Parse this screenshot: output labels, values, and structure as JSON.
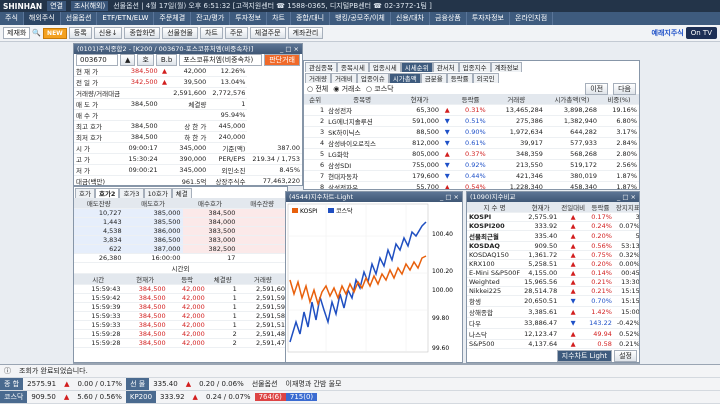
{
  "topbar": {
    "brand": "SHINHAN",
    "tabs": [
      "연결",
      "조사(해외)"
    ],
    "info": "선물옵션  |  4월 17일(월) 오후 6:51:32 [고객지원센터 ☎ 1588-0365, 디지털PB센터 ☎ 02-3772-1팀 ]"
  },
  "menu": [
    "주식",
    "해외주식",
    "선물옵션",
    "ETF/ETN/ELW",
    "주문체결",
    "잔고/평가",
    "투자정보",
    "차트",
    "종합/대니",
    "뱅킹/공모주/이체",
    "신용/대차",
    "금융상품",
    "투자자정보",
    "온라인지점"
  ],
  "toolbar": {
    "screen_no": "제재화",
    "new": "NEW",
    "items": [
      "등록",
      "신용↓",
      "종합화면",
      "선물현물",
      "차트",
      "주문",
      "체결주문",
      "계좌관리"
    ],
    "logo": "예래지주식",
    "tv": "On TV"
  },
  "w1": {
    "title": "(0101)주식종합2 - [K200 / 003670-포스코퓨처엠(비중속차)]",
    "code": "003670",
    "btns": [
      "▲",
      "호",
      "B.b"
    ],
    "name": "포스코퓨처엠(비중속차)",
    "trade_btn": "판단거래",
    "rows": [
      [
        "현 재 가",
        "384,500",
        "▲",
        "42,000",
        "12.26%"
      ],
      [
        "전 일 가",
        "342,500",
        "▲",
        "39,500",
        "13.04%"
      ],
      [
        "거래량/거래대금",
        "",
        "",
        "2,591,600",
        "2,772,576"
      ],
      [
        "매 도 가",
        "384,500",
        "",
        "체결량",
        "1"
      ],
      [
        "매 수 가",
        "",
        "",
        "",
        "95.94%"
      ],
      [
        "최고 호가",
        "384,500",
        "",
        "상 한 가",
        "445,000"
      ],
      [
        "최저 호가",
        "384,500",
        "",
        "하 한 가",
        "240,000"
      ],
      [
        "시   가",
        "09:00:17",
        "",
        "345,000",
        "기준(액)",
        "387.00"
      ],
      [
        "고   가",
        "15:30:24",
        "",
        "390,000",
        "PER/EPS",
        "219.34 / 1,753"
      ],
      [
        "저   가",
        "09:00:21",
        "",
        "345,000",
        "외인소진",
        "8.45%"
      ],
      [
        "대금(백만)",
        "",
        "",
        "961.5억",
        "상장주식수",
        "77,463,220"
      ],
      [
        "시가총액(억)",
        "",
        "",
        "297,846",
        "평균가격",
        "371,308"
      ]
    ]
  },
  "w2": {
    "tabs1": [
      "관심종목",
      "종목시세",
      "업종시세",
      "시세순위",
      "관서처",
      "업종지수",
      "계좌정보"
    ],
    "tabs2": [
      "거래량",
      "거래비",
      "업종이슈",
      "시가총액",
      "금분율",
      "등락률",
      "외국인"
    ],
    "opts": [
      "전체",
      "거래소",
      "코스닥"
    ],
    "btns": [
      "이전",
      "다음"
    ],
    "headers": [
      "순위",
      "종목명",
      "현재가",
      "",
      "등락률",
      "거래량",
      "시가총액(억)",
      "비중(%)"
    ],
    "rows": [
      [
        "1",
        "삼성전자",
        "65,300",
        "▲",
        "0.31%",
        "13,465,284",
        "3,898,268",
        "19.16%"
      ],
      [
        "2",
        "LG에너지솔루션",
        "591,000",
        "▼",
        "0.51%",
        "275,386",
        "1,382,940",
        "6.80%"
      ],
      [
        "3",
        "SK하이닉스",
        "88,500",
        "▼",
        "0.90%",
        "1,972,634",
        "644,282",
        "3.17%"
      ],
      [
        "4",
        "삼성바이오로직스",
        "812,000",
        "▼",
        "0.61%",
        "39,917",
        "577,933",
        "2.84%"
      ],
      [
        "5",
        "LG화학",
        "805,000",
        "▲",
        "0.37%",
        "348,359",
        "568,268",
        "2.80%"
      ],
      [
        "6",
        "삼성SDI",
        "755,000",
        "▼",
        "0.92%",
        "213,550",
        "519,172",
        "2.56%"
      ],
      [
        "7",
        "현대자동차",
        "179,600",
        "▼",
        "0.44%",
        "421,346",
        "380,019",
        "1.87%"
      ],
      [
        "8",
        "삼성전자우",
        "55,700",
        "▲",
        "0.54%",
        "1,228,340",
        "458,340",
        "1.87%"
      ]
    ]
  },
  "w3": {
    "tabs": [
      "호가",
      "호가2",
      "호가3",
      "10호가",
      "체결"
    ],
    "h1": [
      "매도잔량",
      "매도호가",
      "매수호가",
      "매수잔량"
    ],
    "ob": [
      [
        "10,727",
        "385,000",
        "384,500",
        ""
      ],
      [
        "1,443",
        "385,500",
        "384,000",
        ""
      ],
      [
        "4,538",
        "386,000",
        "383,500",
        ""
      ],
      [
        "3,834",
        "386,500",
        "383,000",
        ""
      ],
      [
        "622",
        "387,000",
        "382,500",
        ""
      ]
    ],
    "sum": [
      "26,380",
      "16:00:00",
      "17",
      ""
    ],
    "tl": "시간외",
    "h2": [
      "시간",
      "현재가",
      "등락",
      "체결량",
      "거래량"
    ],
    "ticks": [
      [
        "15:59:43",
        "384,500",
        "42,000",
        "1",
        "2,591,60"
      ],
      [
        "15:59:42",
        "384,500",
        "42,000",
        "1",
        "2,591,59"
      ],
      [
        "15:59:39",
        "384,500",
        "42,000",
        "1",
        "2,591,59"
      ],
      [
        "15:59:33",
        "384,500",
        "42,000",
        "1",
        "2,591,58"
      ],
      [
        "15:59:33",
        "384,500",
        "42,000",
        "1",
        "2,591,51"
      ],
      [
        "15:59:28",
        "384,500",
        "42,000",
        "2",
        "2,591,48"
      ],
      [
        "15:59:28",
        "384,500",
        "42,000",
        "2",
        "2,591,47"
      ]
    ]
  },
  "w4": {
    "title": "(4544)지수차트-Light",
    "legend": [
      "KOSPI",
      "코스닥"
    ],
    "ylabels": [
      "100.40",
      "100.20",
      "100.00",
      "99.80",
      "99.60"
    ]
  },
  "w5": {
    "title": "(1090)지수비교",
    "h": [
      "지 수 명",
      "현재가",
      "전일대비",
      "등락률",
      "장지지표"
    ],
    "rows": [
      [
        "KOSPI",
        "2,575.91",
        "▲",
        "0.17%",
        "3"
      ],
      [
        "KOSPI200",
        "333.92",
        "▲",
        "0.24%",
        "0.07%"
      ],
      [
        "선물최근월",
        "335.40",
        "▲",
        "0.20%",
        "5"
      ],
      [
        "KOSDAQ",
        "909.50",
        "▲",
        "0.56%",
        "53:13"
      ],
      [
        "KOSDAQ150",
        "1,361.72",
        "▲",
        "0.75%",
        "0.32%"
      ],
      [
        "KRX100",
        "5,258.51",
        "▲",
        "0.20%",
        "0.00%"
      ],
      [
        "E-Mini S&P500F",
        "4,155.00",
        "▲",
        "0.14%",
        "00:45"
      ],
      [
        "Weighted",
        "15,965.56",
        "▲",
        "0.21%",
        "13:30"
      ],
      [
        "Nikkei225",
        "28,514.78",
        "▲",
        "0.21%",
        "15:15"
      ],
      [
        "항셍",
        "20,650.51",
        "▼",
        "0.70%",
        "15:15"
      ],
      [
        "상해종합",
        "3,385.61",
        "▲",
        "1.42%",
        "15:00"
      ],
      [
        "다우",
        "33,886.47",
        "▼",
        "143.22",
        "-0.42%"
      ],
      [
        "나스닥",
        "12,123.47",
        "▲",
        "49.94",
        "0.52%"
      ],
      [
        "S&P500",
        "4,137.64",
        "▲",
        "0.58",
        "0.21%"
      ]
    ],
    "btns": [
      "지수차트 Light",
      "설정"
    ]
  },
  "status": "조회가 완료되었습니다.",
  "bottom": [
    [
      "종 합",
      "2575.91",
      "▲",
      "0.00 / 0.17%",
      "선 물",
      "335.40",
      "▲",
      "0.20 / 0.06%",
      "선물옵션",
      "이재명과 간밤 울모"
    ],
    [
      "코스닥",
      "909.50",
      "▲",
      "5.60 / 0.56%",
      "KP200",
      "333.92",
      "▲",
      "0.24 / 0.07%",
      "764(6)",
      "715(0)"
    ]
  ]
}
